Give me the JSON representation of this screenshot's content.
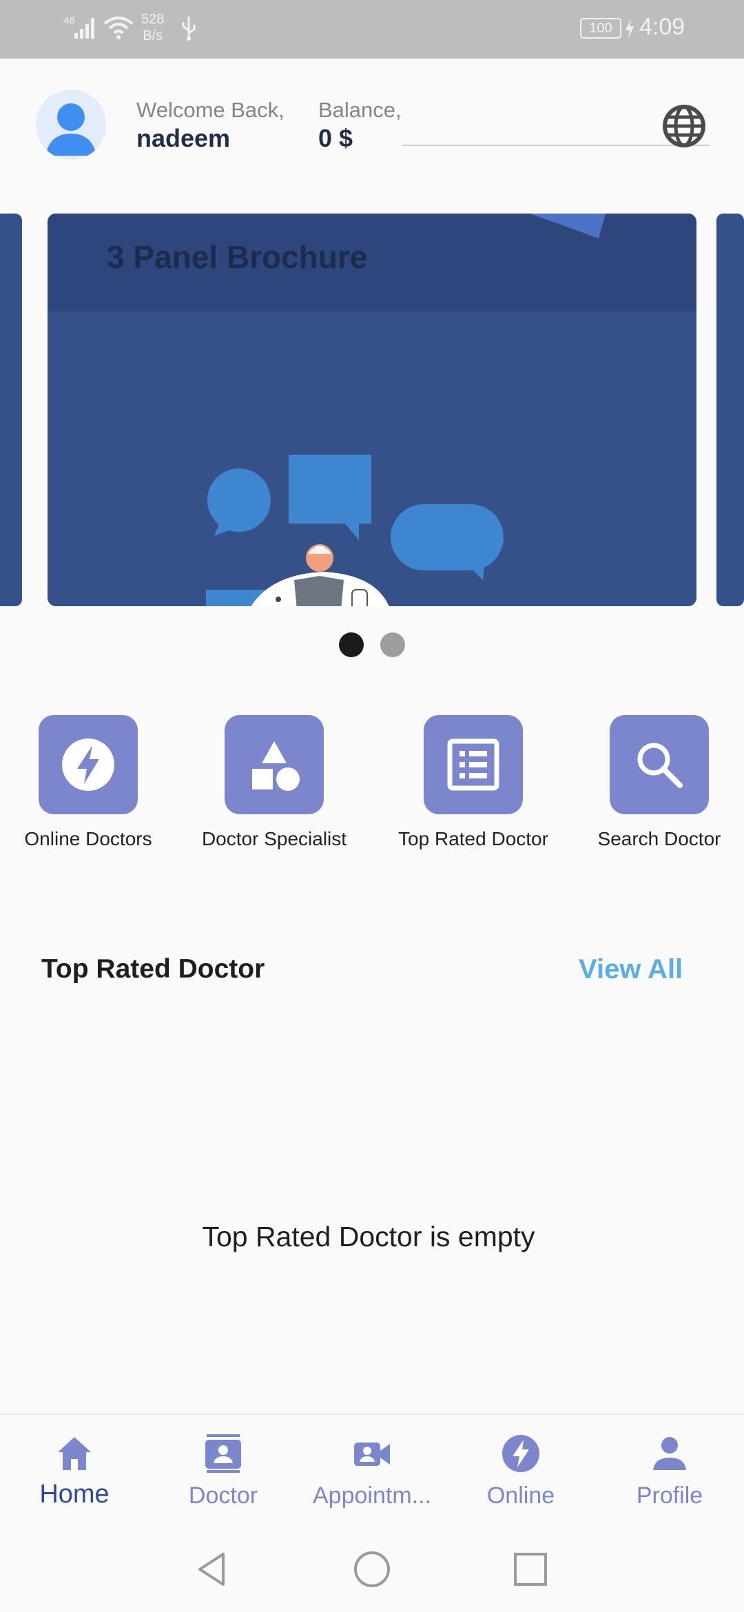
{
  "status_bar": {
    "network": "46",
    "speed_value": "528",
    "speed_unit": "B/s",
    "battery": "100",
    "time": "4:09"
  },
  "header": {
    "welcome_label": "Welcome Back,",
    "username": "nadeem",
    "balance_label": "Balance,",
    "balance_value": "0 $",
    "language_icon": "globe-icon"
  },
  "carousel": {
    "slide_title": "3 Panel Brochure",
    "active_index": 0,
    "dot_count": 2
  },
  "quick_actions": [
    {
      "label": "Online Doctors",
      "icon": "lightning-icon"
    },
    {
      "label": "Doctor Specialist",
      "icon": "shapes-icon"
    },
    {
      "label": "Top Rated Doctor",
      "icon": "list-icon"
    },
    {
      "label": "Search Doctor",
      "icon": "search-icon"
    }
  ],
  "section": {
    "title": "Top Rated Doctor",
    "view_all": "View All",
    "empty_text": "Top Rated Doctor is empty"
  },
  "bottom_nav": [
    {
      "label": "Home",
      "icon": "home-icon",
      "active": true
    },
    {
      "label": "Doctor",
      "icon": "contact-card-icon",
      "active": false
    },
    {
      "label": "Appointm...",
      "icon": "video-camera-icon",
      "active": false
    },
    {
      "label": "Online",
      "icon": "lightning-icon",
      "active": false
    },
    {
      "label": "Profile",
      "icon": "person-icon",
      "active": false
    }
  ],
  "colors": {
    "accent": "#7b86cd",
    "active_nav": "#2f47a0",
    "link": "#5aaee4",
    "banner": "#36508a",
    "status_bar": "#bdbdbd"
  }
}
